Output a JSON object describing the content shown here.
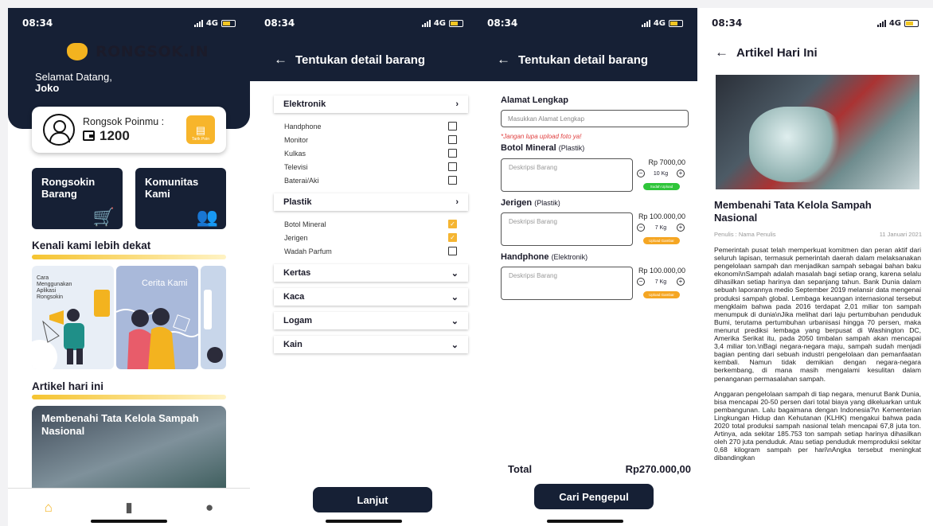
{
  "screens": [
    {
      "status": {
        "time": "08:34",
        "network": "4G"
      },
      "app_name": "RONGSOK.IN",
      "welcome": {
        "greeting": "Selamat Datang,",
        "user": "Joko"
      },
      "points": {
        "label": "Rongsok Poinmu :",
        "value": "1200",
        "withdraw_label": "Tarik Poin"
      },
      "menu": [
        {
          "label": "Rongsokin Barang",
          "icon": "trolley-icon"
        },
        {
          "label": "Komunitas Kami",
          "icon": "community-icon"
        }
      ],
      "section_about": "Kenali kami lebih dekat",
      "banners": [
        {
          "text": "Cara Menggunakan Aplikasi Rongsokin"
        },
        {
          "text": "Cerita Kami"
        }
      ],
      "section_article": "Artikel hari ini",
      "article_card_title": "Membenahi Tata Kelola Sampah Nasional",
      "bottom_nav": [
        "home-icon",
        "note-icon",
        "profile-icon"
      ]
    },
    {
      "status": {
        "time": "08:34",
        "network": "4G"
      },
      "title": "Tentukan detail barang",
      "categories": [
        {
          "name": "Elektronik",
          "expanded": true,
          "items": [
            {
              "label": "Handphone",
              "checked": false
            },
            {
              "label": "Monitor",
              "checked": false
            },
            {
              "label": "Kulkas",
              "checked": false
            },
            {
              "label": "Televisi",
              "checked": false
            },
            {
              "label": "Baterai/Aki",
              "checked": false
            }
          ]
        },
        {
          "name": "Plastik",
          "expanded": true,
          "items": [
            {
              "label": "Botol Mineral",
              "checked": true
            },
            {
              "label": "Jerigen",
              "checked": true
            },
            {
              "label": "Wadah Parfum",
              "checked": false
            }
          ]
        },
        {
          "name": "Kertas",
          "expanded": false,
          "items": []
        },
        {
          "name": "Kaca",
          "expanded": false,
          "items": []
        },
        {
          "name": "Logam",
          "expanded": false,
          "items": []
        },
        {
          "name": "Kain",
          "expanded": false,
          "items": []
        }
      ],
      "next_button": "Lanjut"
    },
    {
      "status": {
        "time": "08:34",
        "network": "4G"
      },
      "title": "Tentukan detail barang",
      "address_label": "Alamat Lengkap",
      "address_placeholder": "Masukkan Alamat Lengkap",
      "warning": "*Jangan lupa upload foto ya!",
      "items": [
        {
          "name": "Botol Mineral",
          "category": "(Plastik)",
          "desc_placeholder": "Deskripsi Barang",
          "price": "Rp      7000,00",
          "qty": "10 Kg",
          "upload_label": "Sudah Upload",
          "upload_color": "#2fc53a"
        },
        {
          "name": "Jerigen",
          "category": "(Plastik)",
          "desc_placeholder": "Deskripsi Barang",
          "price": "Rp 100.000,00",
          "qty": "7 Kg",
          "upload_label": "Upload Gambar",
          "upload_color": "#f5a623"
        },
        {
          "name": "Handphone",
          "category": "(Elektronik)",
          "desc_placeholder": "Deskripsi Barang",
          "price": "Rp 100.000,00",
          "qty": "7 Kg",
          "upload_label": "Upload Gambar",
          "upload_color": "#f5a623"
        }
      ],
      "total_label": "Total",
      "total_value": "Rp270.000,00",
      "submit_button": "Cari Pengepul"
    },
    {
      "status": {
        "time": "08:34",
        "network": "4G"
      },
      "title": "Artikel Hari Ini",
      "article_title": "Membenahi Tata Kelola Sampah Nasional",
      "author": "Penulis : Nama Penulis",
      "date": "11 Januari 2021",
      "paragraphs": [
        "Pemerintah pusat telah memperkuat komitmen dan peran aktif dari seluruh lapisan, termasuk pemerintah daerah dalam melaksanakan pengelolaan sampah dan menjadikan sampah sebagai bahan baku ekonomi\\nSampah adalah masalah bagi setiap orang, karena selalu dihasilkan setiap harinya dan sepanjang tahun. Bank Dunia dalam sebuah laporannya medio September 2019 melansir data mengenai produksi sampah global. Lembaga keuangan internasional tersebut mengklaim bahwa pada 2016 terdapat 2,01 miliar ton sampah menumpuk di dunia\\nJika melihat dari laju pertumbuhan penduduk Bumi, terutama pertumbuhan urbanisasi hingga 70 persen, maka menurut prediksi lembaga yang berpusat di Washington DC, Amerika Serikat itu, pada 2050 timbalan sampah akan mencapai 3,4 miliar ton.\\nBagi negara-negara maju, sampah sudah menjadi bagian penting dari sebuah industri pengelolaan dan pemanfaatan kembali. Namun tidak demikian dengan negara-negara berkembang, di mana masih mengalami kesulitan dalam penanganan permasalahan sampah.",
        "Anggaran pengelolaan sampah di tiap negara, menurut Bank Dunia, bisa mencapai 20-50 persen dari total biaya yang dikeluarkan untuk pembangunan. Lalu bagaimana dengan Indonesia?\\n Kementerian Lingkungan Hidup dan Kehutanan (KLHK) mengakui bahwa pada 2020 total produksi sampah nasional telah mencapai 67,8 juta ton. Artinya, ada sekitar 185.753 ton sampah setiap harinya dihasilkan oleh 270 juta penduduk. Atau setiap penduduk memproduksi sekitar 0,68 kilogram sampah per hari\\nAngka tersebut meningkat dibandingkan"
      ]
    }
  ]
}
